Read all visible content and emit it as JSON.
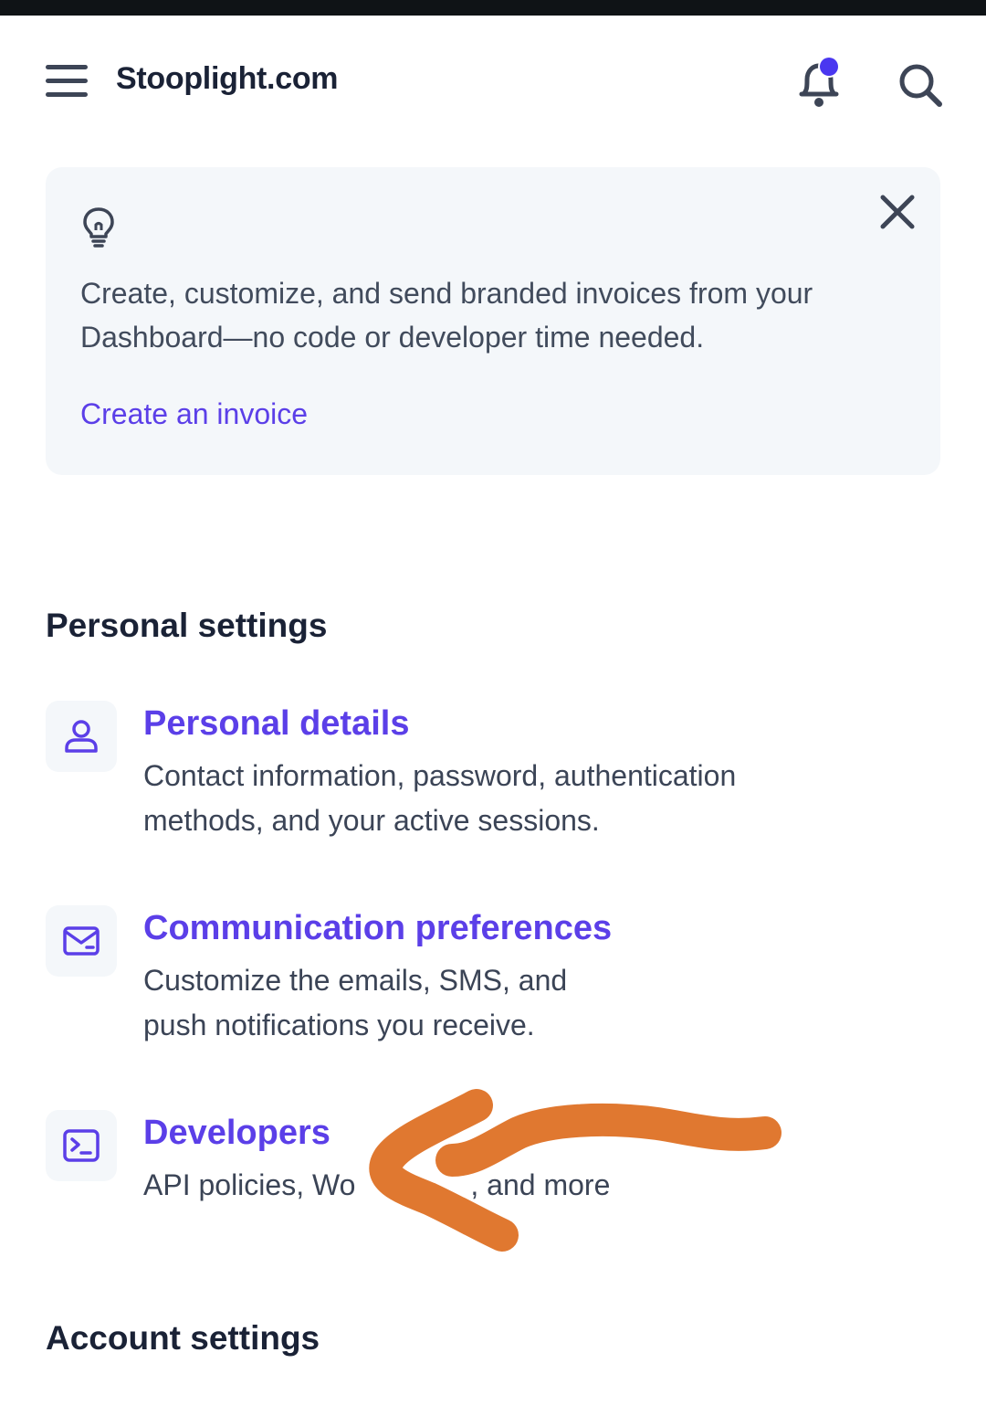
{
  "header": {
    "title": "Stooplight.com",
    "notification_dot_color": "#4a37f0"
  },
  "promo": {
    "icon": "lightbulb-icon",
    "text": "Create, customize, and send branded invoices from your Dashboard—no code or developer time needed.",
    "link_label": "Create an invoice"
  },
  "sections": {
    "personal": {
      "title": "Personal settings",
      "items": [
        {
          "icon": "user-icon",
          "title": "Personal details",
          "description_line1": "Contact information, password, authentication",
          "description_line2": "methods, and your active sessions."
        },
        {
          "icon": "mail-icon",
          "title": "Communication preferences",
          "description_line1": "Customize the emails, SMS, and",
          "description_line2": "push notifications you receive."
        },
        {
          "icon": "terminal-icon",
          "title": "Developers",
          "description_line1": "API policies, Wo",
          "description_line2": ", and more"
        }
      ]
    },
    "account": {
      "title": "Account settings"
    }
  },
  "colors": {
    "accent": "#5b3fe8",
    "annotation": "#e07830",
    "text_primary": "#1a2236",
    "text_secondary": "#414b5c",
    "card_background": "#f4f7fa"
  }
}
